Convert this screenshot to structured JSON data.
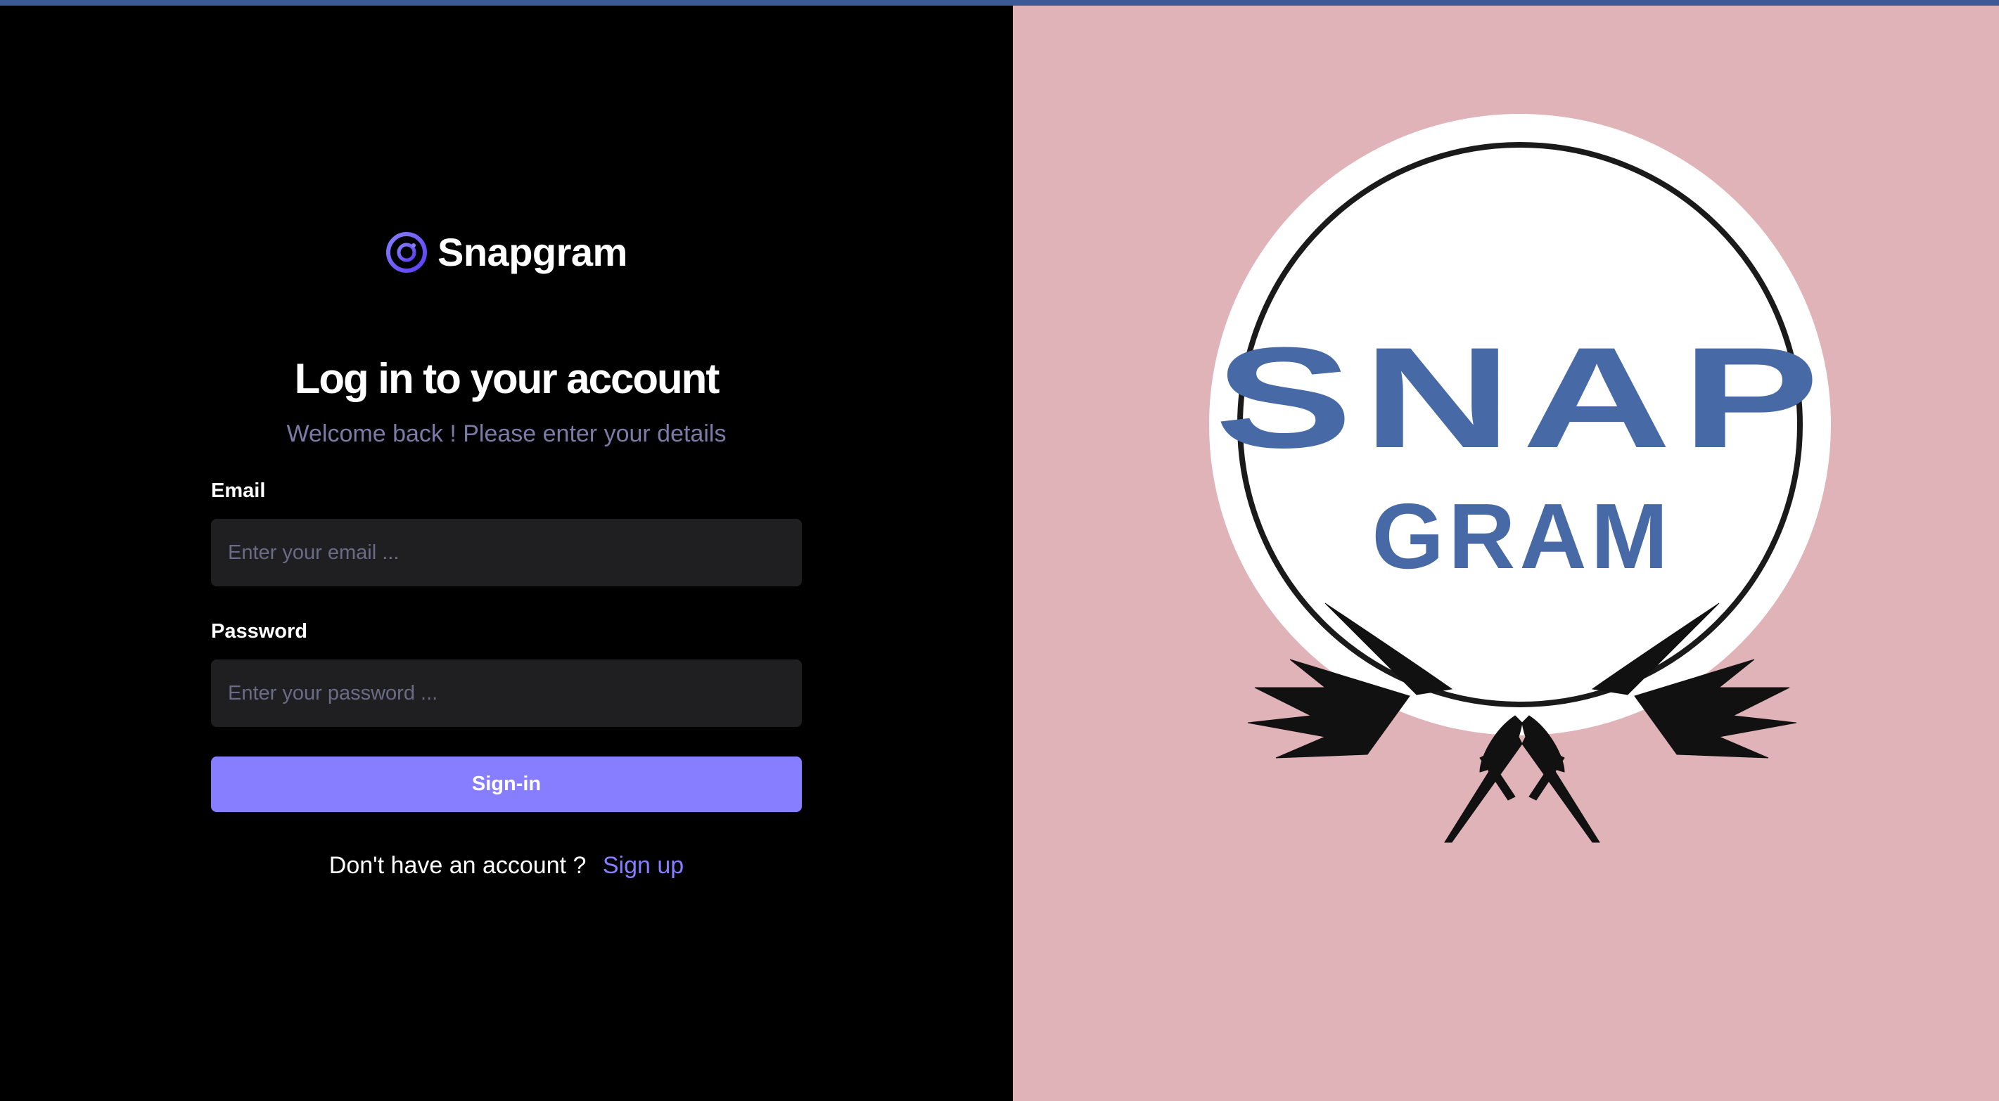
{
  "brand": {
    "name": "Snapgram",
    "accent_color": "#877eff",
    "icon": "snapgram-logo-icon"
  },
  "form": {
    "title": "Log in to your account",
    "subtitle": "Welcome back ! Please enter your details",
    "email_label": "Email",
    "email_placeholder": "Enter your email ...",
    "email_value": "",
    "password_label": "Password",
    "password_placeholder": "Enter your password ...",
    "password_value": "",
    "submit_label": "Sign-in"
  },
  "footer": {
    "prompt": "Don't have an account ?",
    "signup_link": "Sign up"
  },
  "hero": {
    "logo_text_top": "SNAP",
    "logo_text_bottom": "GRAM",
    "background_color": "#e0b3b9",
    "logo_color": "#476aa6"
  }
}
